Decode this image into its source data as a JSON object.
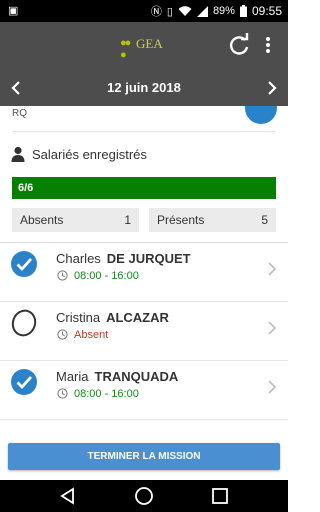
{
  "status_bar": {
    "battery": "89%",
    "time": "09:55"
  },
  "app_bar": {
    "logo_text": "GEA",
    "logo_tagline": ""
  },
  "date_bar": {
    "date": "12 juin 2018"
  },
  "header_partial": {
    "code": "RQ"
  },
  "section": {
    "title": "Salariés enregistrés"
  },
  "progress": {
    "label": "6/6",
    "value": 1.0,
    "color": "#078000"
  },
  "stats": {
    "absent_label": "Absents",
    "absent_count": "1",
    "present_label": "Présents",
    "present_count": "5"
  },
  "employees": [
    {
      "first_name": "Charles",
      "last_name": "DE JURQUET",
      "status": "08:00 - 16:00",
      "checked": true
    },
    {
      "first_name": "Cristina",
      "last_name": "ALCAZAR",
      "status": "Absent",
      "checked": false
    },
    {
      "first_name": "Maria",
      "last_name": "TRANQUADA",
      "status": "08:00 - 16:00",
      "checked": true
    }
  ],
  "action": {
    "label": "TERMINER LA MISSION"
  },
  "colors": {
    "accent": "#2a83c9",
    "appbar": "#4d4d4d",
    "present": "#178a1a",
    "absent": "#c0392b",
    "button": "#4a8fd1"
  },
  "icons": [
    "refresh-icon",
    "more-vert-icon",
    "chevron-left-icon",
    "chevron-right-icon",
    "person-icon",
    "check-circle-icon",
    "absent-circle-icon",
    "clock-icon"
  ]
}
